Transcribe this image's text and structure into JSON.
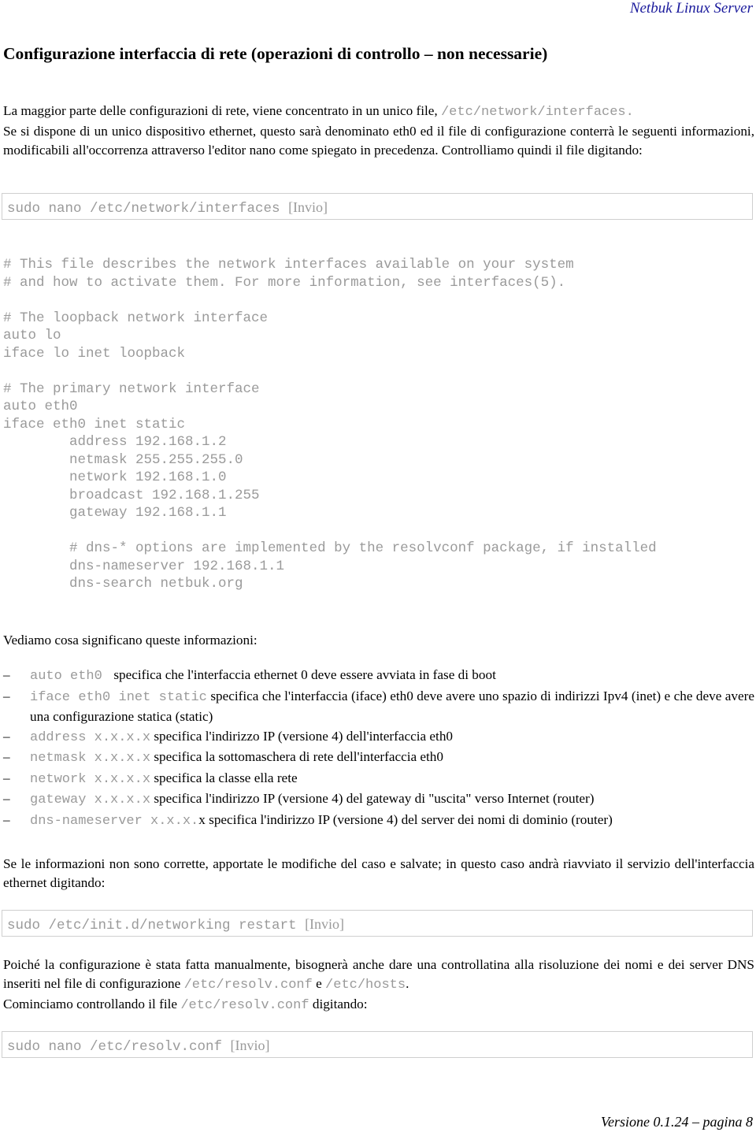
{
  "header": {
    "brand": "Netbuk Linux Server"
  },
  "title": "Configurazione interfaccia di rete (operazioni di controllo – non necessarie)",
  "intro": {
    "line1_text": "La maggior parte delle configurazioni di rete, viene concentrato in un unico file, ",
    "line1_path": "/etc/network/interfaces.",
    "paragraph": "Se si dispone di un unico dispositivo ethernet, questo sarà denominato eth0 ed il file di configurazione conterrà le seguenti informazioni, modificabili all'occorrenza attraverso l'editor nano come spiegato in precedenza. Controlliamo quindi il file digitando:"
  },
  "command1": {
    "code": "sudo nano /etc/network/interfaces ",
    "key": "[Invio]"
  },
  "config_file": {
    "lines": [
      "# This file describes the network interfaces available on your system",
      "# and how to activate them. For more information, see interfaces(5).",
      "",
      "# The loopback network interface",
      "auto lo",
      "iface lo inet loopback",
      "",
      "# The primary network interface",
      "auto eth0",
      "iface eth0 inet static",
      "        address 192.168.1.2",
      "        netmask 255.255.255.0",
      "        network 192.168.1.0",
      "        broadcast 192.168.1.255",
      "        gateway 192.168.1.1",
      "",
      "        # dns-* options are implemented by the resolvconf package, if installed",
      "        dns-nameserver 192.168.1.1",
      "        dns-search netbuk.org"
    ]
  },
  "explain_intro": "Vediamo cosa significano queste informazioni:",
  "bullets": [
    {
      "dash": "–",
      "code": "auto eth0 ",
      "text": " specifica che l'interfaccia ethernet 0 deve essere avviata in fase di boot"
    },
    {
      "dash": "–",
      "code": "iface eth0 inet static",
      "text": " specifica che l'interfaccia (iface) eth0 deve avere uno spazio di indirizzi Ipv4 (inet) e che deve avere una configurazione statica (static)"
    },
    {
      "dash": "–",
      "code": "address x.x.x.x",
      "text": " specifica l'indirizzo IP (versione 4) dell'interfaccia eth0"
    },
    {
      "dash": "–",
      "code": "netmask x.x.x.x",
      "text": " specifica la sottomaschera di rete dell'interfaccia eth0"
    },
    {
      "dash": "–",
      "code": "network x.x.x.x",
      "text": " specifica la  classe ella rete"
    },
    {
      "dash": "–",
      "code": "gateway x.x.x.x",
      "text": " specifica l'indirizzo IP (versione 4) del gateway di \"uscita\" verso Internet (router)"
    },
    {
      "dash": "–",
      "code": "dns-nameserver x.x.x.",
      "text": "x specifica l'indirizzo IP (versione 4) del server dei nomi di dominio (router)"
    }
  ],
  "restart_paragraph": "Se le informazioni non sono corrette, apportate le modifiche del caso e salvate; in questo caso andrà riavviato il servizio dell'interfaccia ethernet digitando:",
  "command2": {
    "code": "sudo /etc/init.d/networking restart ",
    "key": "[Invio]"
  },
  "dns_paragraph": {
    "text1": "Poiché la configurazione è stata fatta manualmente, bisognerà anche dare una controllatina alla risoluzione dei nomi e dei server DNS inseriti nel file di configurazione ",
    "path1": " /etc/resolv.conf",
    "text2": " e ",
    "path2": "/etc/hosts",
    "text3": ".",
    "line2_text1": "Cominciamo controllando il file ",
    "line2_path": "/etc/resolv.conf",
    "line2_text2": " digitando:"
  },
  "command3": {
    "code": "sudo nano /etc/resolv.conf ",
    "key": "[Invio]"
  },
  "footer": {
    "version": "Versione 0.1.24 – pagina 8"
  }
}
